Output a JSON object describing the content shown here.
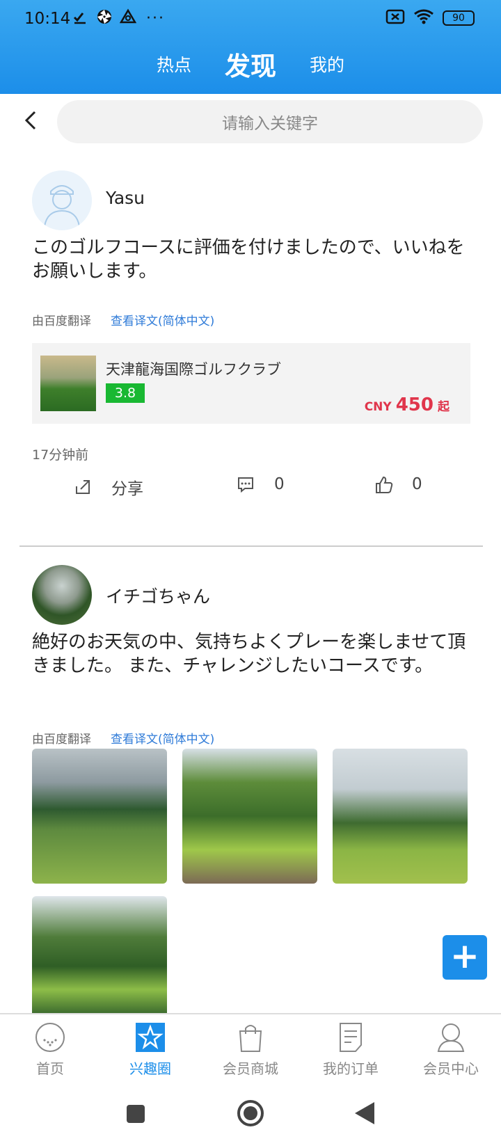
{
  "status_bar": {
    "time": "10:14",
    "dots": "···",
    "battery": "90"
  },
  "header": {
    "tabs": [
      {
        "label": "热点",
        "active": false
      },
      {
        "label": "发现",
        "active": true
      },
      {
        "label": "我的",
        "active": false
      }
    ]
  },
  "search": {
    "placeholder": "请输入关键字"
  },
  "posts": [
    {
      "author": "Yasu",
      "text": "このゴルフコースに評価を付けましたので、いいねをお願いします。",
      "translated_by": "由百度翻译",
      "translate_link": "查看译文(简体中文)",
      "course": {
        "name": "天津龍海国際ゴルフクラブ",
        "rating": "3.8",
        "currency": "CNY",
        "price": "450",
        "price_suffix": "起"
      },
      "time": "17分钟前",
      "share_label": "分享",
      "comment_count": "0",
      "like_count": "0"
    },
    {
      "author": "イチゴちゃん",
      "text": "絶好のお天気の中、気持ちよくプレーを楽しませて頂きました。 また、チャレンジしたいコースです。",
      "translated_by": "由百度翻译",
      "translate_link": "查看译文(简体中文)",
      "photo_count": 4
    }
  ],
  "fab_label": "+",
  "bottom_nav": [
    {
      "label": "首页",
      "icon": "golf-ball-icon",
      "active": false
    },
    {
      "label": "兴趣圈",
      "icon": "star-icon",
      "active": true
    },
    {
      "label": "会员商城",
      "icon": "shopping-bag-icon",
      "active": false
    },
    {
      "label": "我的订单",
      "icon": "order-document-icon",
      "active": false
    },
    {
      "label": "会员中心",
      "icon": "person-icon",
      "active": false
    }
  ],
  "colors": {
    "brand_blue": "#1c8ee9",
    "rating_green": "#19b832",
    "price_red": "#e0354b"
  }
}
